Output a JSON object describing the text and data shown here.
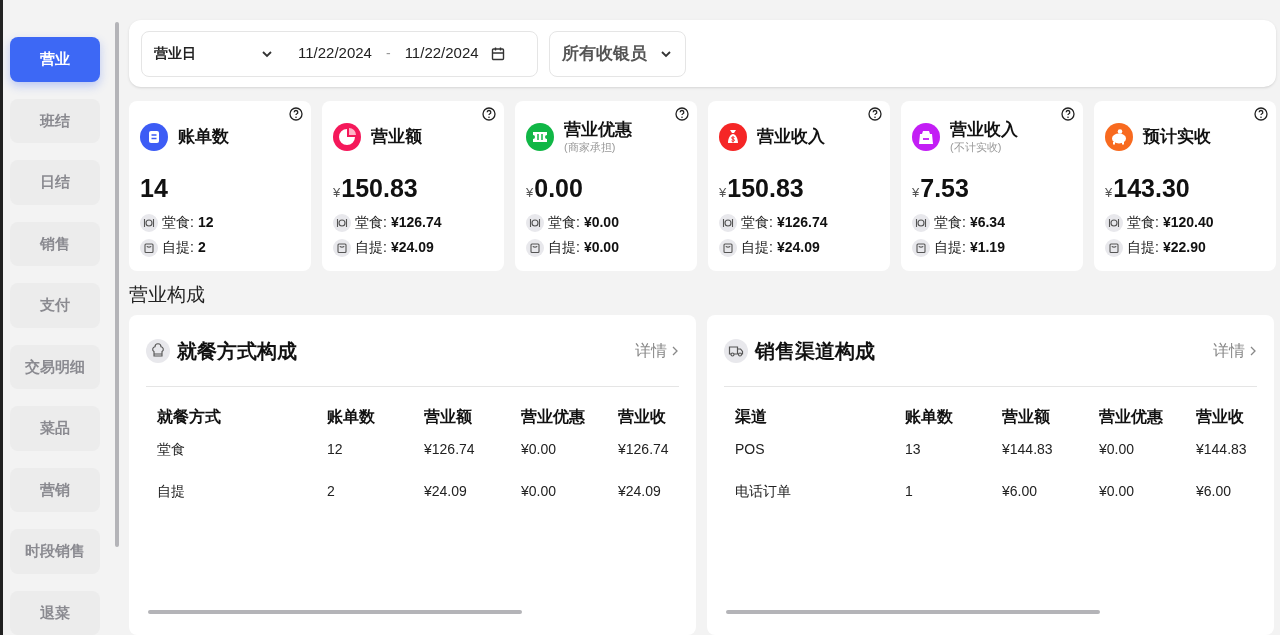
{
  "sidebar": {
    "items": [
      {
        "label": "营业",
        "selected": true
      },
      {
        "label": "班结",
        "selected": false
      },
      {
        "label": "日结",
        "selected": false
      },
      {
        "label": "销售",
        "selected": false
      },
      {
        "label": "支付",
        "selected": false
      },
      {
        "label": "交易明细",
        "selected": false
      },
      {
        "label": "菜品",
        "selected": false
      },
      {
        "label": "营销",
        "selected": false
      },
      {
        "label": "时段销售",
        "selected": false
      },
      {
        "label": "退菜",
        "selected": false
      }
    ]
  },
  "filters": {
    "period": "营业日",
    "date_from": "11/22/2024",
    "date_separator": "-",
    "date_to": "11/22/2024",
    "cashier": "所有收银员"
  },
  "cards": [
    {
      "kind": "bill",
      "color": "#3d5cf5",
      "title": "账单数",
      "value": "14",
      "dine_in_label": "堂食:",
      "dine_in": "12",
      "pickup_label": "自提:",
      "pickup": "2"
    },
    {
      "kind": "pie",
      "color": "#f5185a",
      "title": "营业额",
      "currency": "¥",
      "value": "150.83",
      "dine_in_label": "堂食:",
      "dine_in": "¥126.74",
      "pickup_label": "自提:",
      "pickup": "¥24.09"
    },
    {
      "kind": "ticket",
      "color": "#10b746",
      "title": "营业优惠",
      "subtitle": "(商家承担)",
      "currency": "¥",
      "value": "0.00",
      "dine_in_label": "堂食:",
      "dine_in": "¥0.00",
      "pickup_label": "自提:",
      "pickup": "¥0.00"
    },
    {
      "kind": "moneybag",
      "color": "#f52626",
      "title": "营业收入",
      "currency": "¥",
      "value": "150.83",
      "dine_in_label": "堂食:",
      "dine_in": "¥126.74",
      "pickup_label": "自提:",
      "pickup": "¥24.09"
    },
    {
      "kind": "weight",
      "color": "#c31ef5",
      "title": "营业收入",
      "subtitle": "(不计实收)",
      "currency": "¥",
      "value": "7.53",
      "dine_in_label": "堂食:",
      "dine_in": "¥6.34",
      "pickup_label": "自提:",
      "pickup": "¥1.19"
    },
    {
      "kind": "piggy",
      "color": "#f86a1f",
      "title": "预计实收",
      "currency": "¥",
      "value": "143.30",
      "dine_in_label": "堂食:",
      "dine_in": "¥120.40",
      "pickup_label": "自提:",
      "pickup": "¥22.90"
    }
  ],
  "section_title": "营业构成",
  "panels": [
    {
      "kind": "chef",
      "title": "就餐方式构成",
      "detail_link": "详情",
      "columns": [
        "就餐方式",
        "账单数",
        "营业额",
        "营业优惠",
        "营业收"
      ],
      "rows": [
        [
          "堂食",
          "12",
          "¥126.74",
          "¥0.00",
          "¥126.74"
        ],
        [
          "自提",
          "2",
          "¥24.09",
          "¥0.00",
          "¥24.09"
        ]
      ]
    },
    {
      "kind": "truck",
      "title": "销售渠道构成",
      "detail_link": "详情",
      "columns": [
        "渠道",
        "账单数",
        "营业额",
        "营业优惠",
        "营业收"
      ],
      "rows": [
        [
          "POS",
          "13",
          "¥144.83",
          "¥0.00",
          "¥144.83"
        ],
        [
          "电话订单",
          "1",
          "¥6.00",
          "¥0.00",
          "¥6.00"
        ]
      ]
    }
  ]
}
